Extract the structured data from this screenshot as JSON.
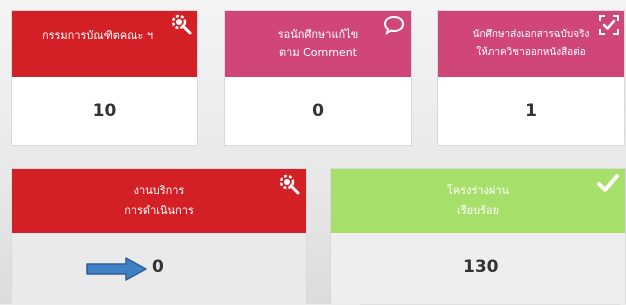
{
  "cards": [
    {
      "lines": [
        "กรรมการบัณฑิตคณะ ฯ"
      ],
      "value": "10",
      "icon": "gear-magnify-icon",
      "color": "#d31f26"
    },
    {
      "lines": [
        "รอนักศึกษาแก้ไข",
        "ตาม Comment"
      ],
      "value": "0",
      "icon": "speech-bubble-icon",
      "color": "#d04679"
    },
    {
      "lines": [
        "นักศึกษาส่งเอกสารฉบับจริง",
        "ให้ภาควิชาออกหนังสือต่อ"
      ],
      "value": "1",
      "icon": "scan-check-icon",
      "color": "#d04679"
    },
    {
      "lines": [
        "งานบริการ",
        "การดำเนินการ"
      ],
      "value": "0",
      "icon": "gear-magnify-icon",
      "color": "#d31f26"
    },
    {
      "lines": [
        "โครงร่างผ่าน",
        "เรียบร้อย"
      ],
      "value": "130",
      "icon": "checkmark-icon",
      "color": "#a6e06a"
    }
  ],
  "annotation": {
    "icon": "blue-arrow-icon",
    "color": "#3f7fc3"
  }
}
